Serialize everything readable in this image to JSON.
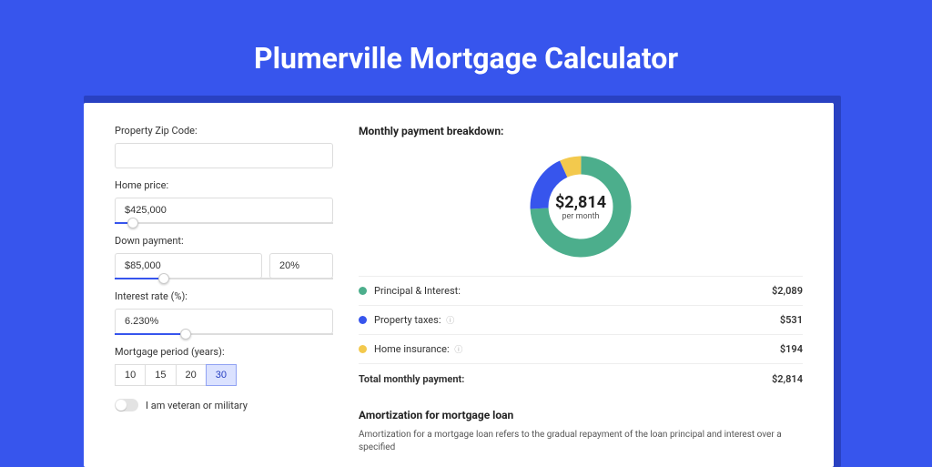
{
  "title": "Plumerville Mortgage Calculator",
  "form": {
    "zip_label": "Property Zip Code:",
    "zip_value": "",
    "home_price_label": "Home price:",
    "home_price_value": "$425,000",
    "home_price_slider_pct": 6,
    "down_payment_label": "Down payment:",
    "down_payment_value": "$85,000",
    "down_payment_pct_value": "20%",
    "down_payment_slider_pct": 20,
    "interest_label": "Interest rate (%):",
    "interest_value": "6.230%",
    "interest_slider_pct": 30,
    "period_label": "Mortgage period (years):",
    "periods": [
      "10",
      "15",
      "20",
      "30"
    ],
    "period_active": "30",
    "veteran_label": "I am veteran or military"
  },
  "breakdown": {
    "title": "Monthly payment breakdown:",
    "center_value": "$2,814",
    "center_sub": "per month",
    "items": [
      {
        "label": "Principal & Interest:",
        "value": "$2,089",
        "color": "#4cae8c",
        "info": false
      },
      {
        "label": "Property taxes:",
        "value": "$531",
        "color": "#3755ed",
        "info": true
      },
      {
        "label": "Home insurance:",
        "value": "$194",
        "color": "#f3c94d",
        "info": true
      }
    ],
    "total_label": "Total monthly payment:",
    "total_value": "$2,814"
  },
  "chart_data": {
    "type": "pie",
    "title": "Monthly payment breakdown",
    "series": [
      {
        "name": "Principal & Interest",
        "value": 2089,
        "color": "#4cae8c"
      },
      {
        "name": "Property taxes",
        "value": 531,
        "color": "#3755ed"
      },
      {
        "name": "Home insurance",
        "value": 194,
        "color": "#f3c94d"
      }
    ],
    "total": 2814
  },
  "amort": {
    "title": "Amortization for mortgage loan",
    "text": "Amortization for a mortgage loan refers to the gradual repayment of the loan principal and interest over a specified"
  }
}
